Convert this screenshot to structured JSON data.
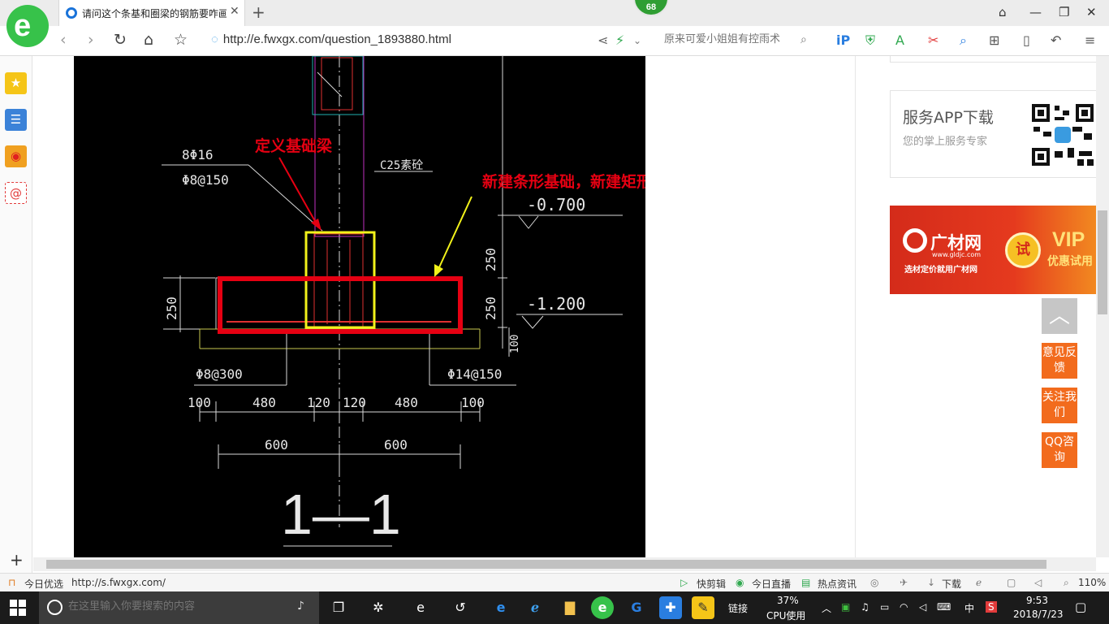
{
  "browser": {
    "tab_title": "请问这个条基和圈梁的钢筋要咋画",
    "tab_close": "✕",
    "new_tab": "+",
    "badge_count": "68",
    "url": "http://e.fwxgx.com/question_1893880.html",
    "search_placeholder": "原来可爱小姐姐有控雨术"
  },
  "cad": {
    "labels": {
      "rebar_top_1": "8Φ16",
      "rebar_top_2": "Φ8@150",
      "column_note": "C25素砼",
      "elev_1": "-0.700",
      "elev_2": "-1.200",
      "dim_250_left": "250",
      "dim_250_r1": "250",
      "dim_250_r2": "250",
      "dim_100_r": "100",
      "rebar_bottom_left": "Φ8@300",
      "rebar_bottom_right": "Φ14@150",
      "dim_row1": [
        "100",
        "480",
        "120",
        "120",
        "480",
        "100"
      ],
      "dim_row2": [
        "600",
        "600"
      ],
      "section_title": "1—1"
    },
    "annotation_red": "定义基础梁",
    "annotation_yellow": "新建条形基础，新建矩形条形基础单元"
  },
  "sidebar_right": {
    "app_title": "服务APP下载",
    "app_subtitle": "您的掌上服务专家",
    "ad": {
      "brand": "广材网",
      "url": "www.gldjc.com",
      "slogan": "选材定价就用广材网",
      "try": "试",
      "vip": "VIP",
      "vip_sub": "优惠试用"
    }
  },
  "floating": {
    "top_icon": "︿",
    "feedback": "意见反馈",
    "follow": "关注我们",
    "qq": "QQ咨询"
  },
  "status_bar": {
    "today": "今日优选",
    "link": "http://s.fwxgx.com/",
    "items": [
      "快剪辑",
      "今日直播",
      "热点资讯",
      "下载"
    ],
    "zoom": "110%"
  },
  "taskbar": {
    "search_placeholder": "在这里输入你要搜索的内容",
    "link_label": "链接",
    "cpu_percent": "37%",
    "cpu_label": "CPU使用",
    "ime": "中",
    "time": "9:53",
    "date": "2018/7/23"
  },
  "colors": {
    "brand_green": "#37c24a",
    "annotation_red": "#e60012",
    "annotation_yellow": "#f2f21a",
    "float_orange": "#f26b1d"
  }
}
